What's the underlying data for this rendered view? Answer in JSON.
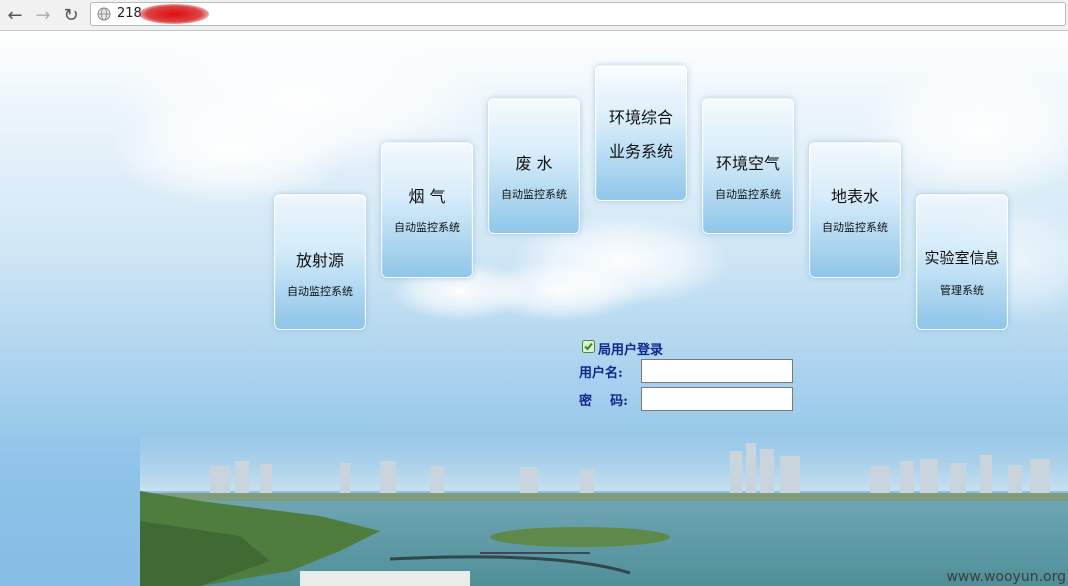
{
  "browser": {
    "url_visible": "218",
    "back_glyph": "←",
    "forward_glyph": "→",
    "reload_glyph": "↻"
  },
  "tiles": [
    {
      "title": "放射源",
      "subtitle": "自动监控系统"
    },
    {
      "title": "烟 气",
      "subtitle": "自动监控系统"
    },
    {
      "title": "废 水",
      "subtitle": "自动监控系统"
    },
    {
      "title": "环境综合",
      "subtitle": "业务系统"
    },
    {
      "title": "环境空气",
      "subtitle": "自动监控系统"
    },
    {
      "title": "地表水",
      "subtitle": "自动监控系统"
    },
    {
      "title": "实验室信息",
      "subtitle": "管理系统"
    }
  ],
  "login": {
    "title": "局用户登录",
    "username_label": "用户名:",
    "password_label": "密    码:",
    "username_value": "",
    "password_value": ""
  },
  "watermark": "www.wooyun.org",
  "colors": {
    "login_text": "#10268c",
    "url_redaction": "#d40000"
  },
  "icons": {
    "back": "back-arrow-icon",
    "forward": "forward-arrow-icon",
    "reload": "reload-icon",
    "site": "globe-icon",
    "login_check": "checkbox-icon"
  }
}
